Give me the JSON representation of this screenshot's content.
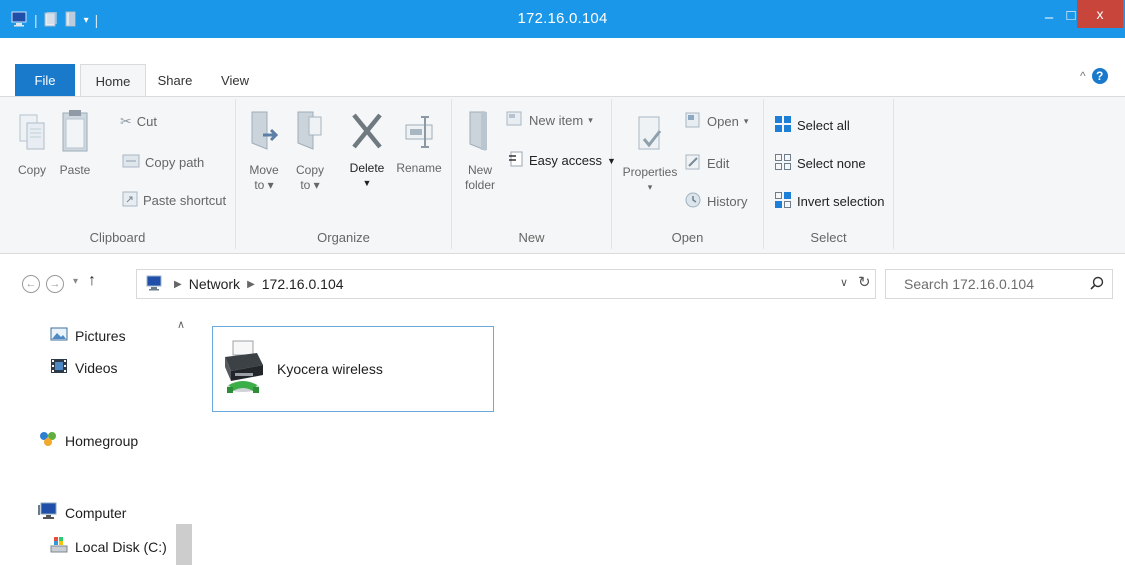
{
  "window": {
    "title": "172.16.0.104",
    "minimize": "–",
    "maximize": "□",
    "close": "x"
  },
  "ribbon_tabs": {
    "file": "File",
    "home": "Home",
    "share": "Share",
    "view": "View"
  },
  "ribbon_collapse": "^",
  "help": "?",
  "clipboard": {
    "group_label": "Clipboard",
    "copy": "Copy",
    "paste": "Paste",
    "cut": "Cut",
    "copy_path": "Copy path",
    "paste_shortcut": "Paste shortcut"
  },
  "organize": {
    "group_label": "Organize",
    "move_to_line1": "Move",
    "move_to_line2": "to",
    "copy_to_line1": "Copy",
    "copy_to_line2": "to",
    "delete": "Delete",
    "rename": "Rename"
  },
  "new": {
    "group_label": "New",
    "new_folder_line1": "New",
    "new_folder_line2": "folder",
    "new_item": "New item",
    "easy_access": "Easy access"
  },
  "open": {
    "group_label": "Open",
    "properties": "Properties",
    "open": "Open",
    "edit": "Edit",
    "history": "History"
  },
  "select": {
    "group_label": "Select",
    "select_all": "Select all",
    "select_none": "Select none",
    "invert_selection": "Invert selection"
  },
  "address": {
    "crumbs": [
      "Network",
      "172.16.0.104"
    ]
  },
  "search": {
    "placeholder": "Search 172.16.0.104"
  },
  "nav_pane": {
    "items": [
      "Pictures",
      "Videos",
      "Homegroup",
      "Computer",
      "Local Disk (C:)"
    ]
  },
  "content": {
    "items": [
      {
        "label": "Kyocera wireless",
        "icon": "network-printer-icon"
      }
    ]
  },
  "colors": {
    "titlebar": "#1a97e8",
    "file_tab": "#1979ca",
    "close_button": "#c7453a",
    "selection_border": "#6ba8dc"
  }
}
